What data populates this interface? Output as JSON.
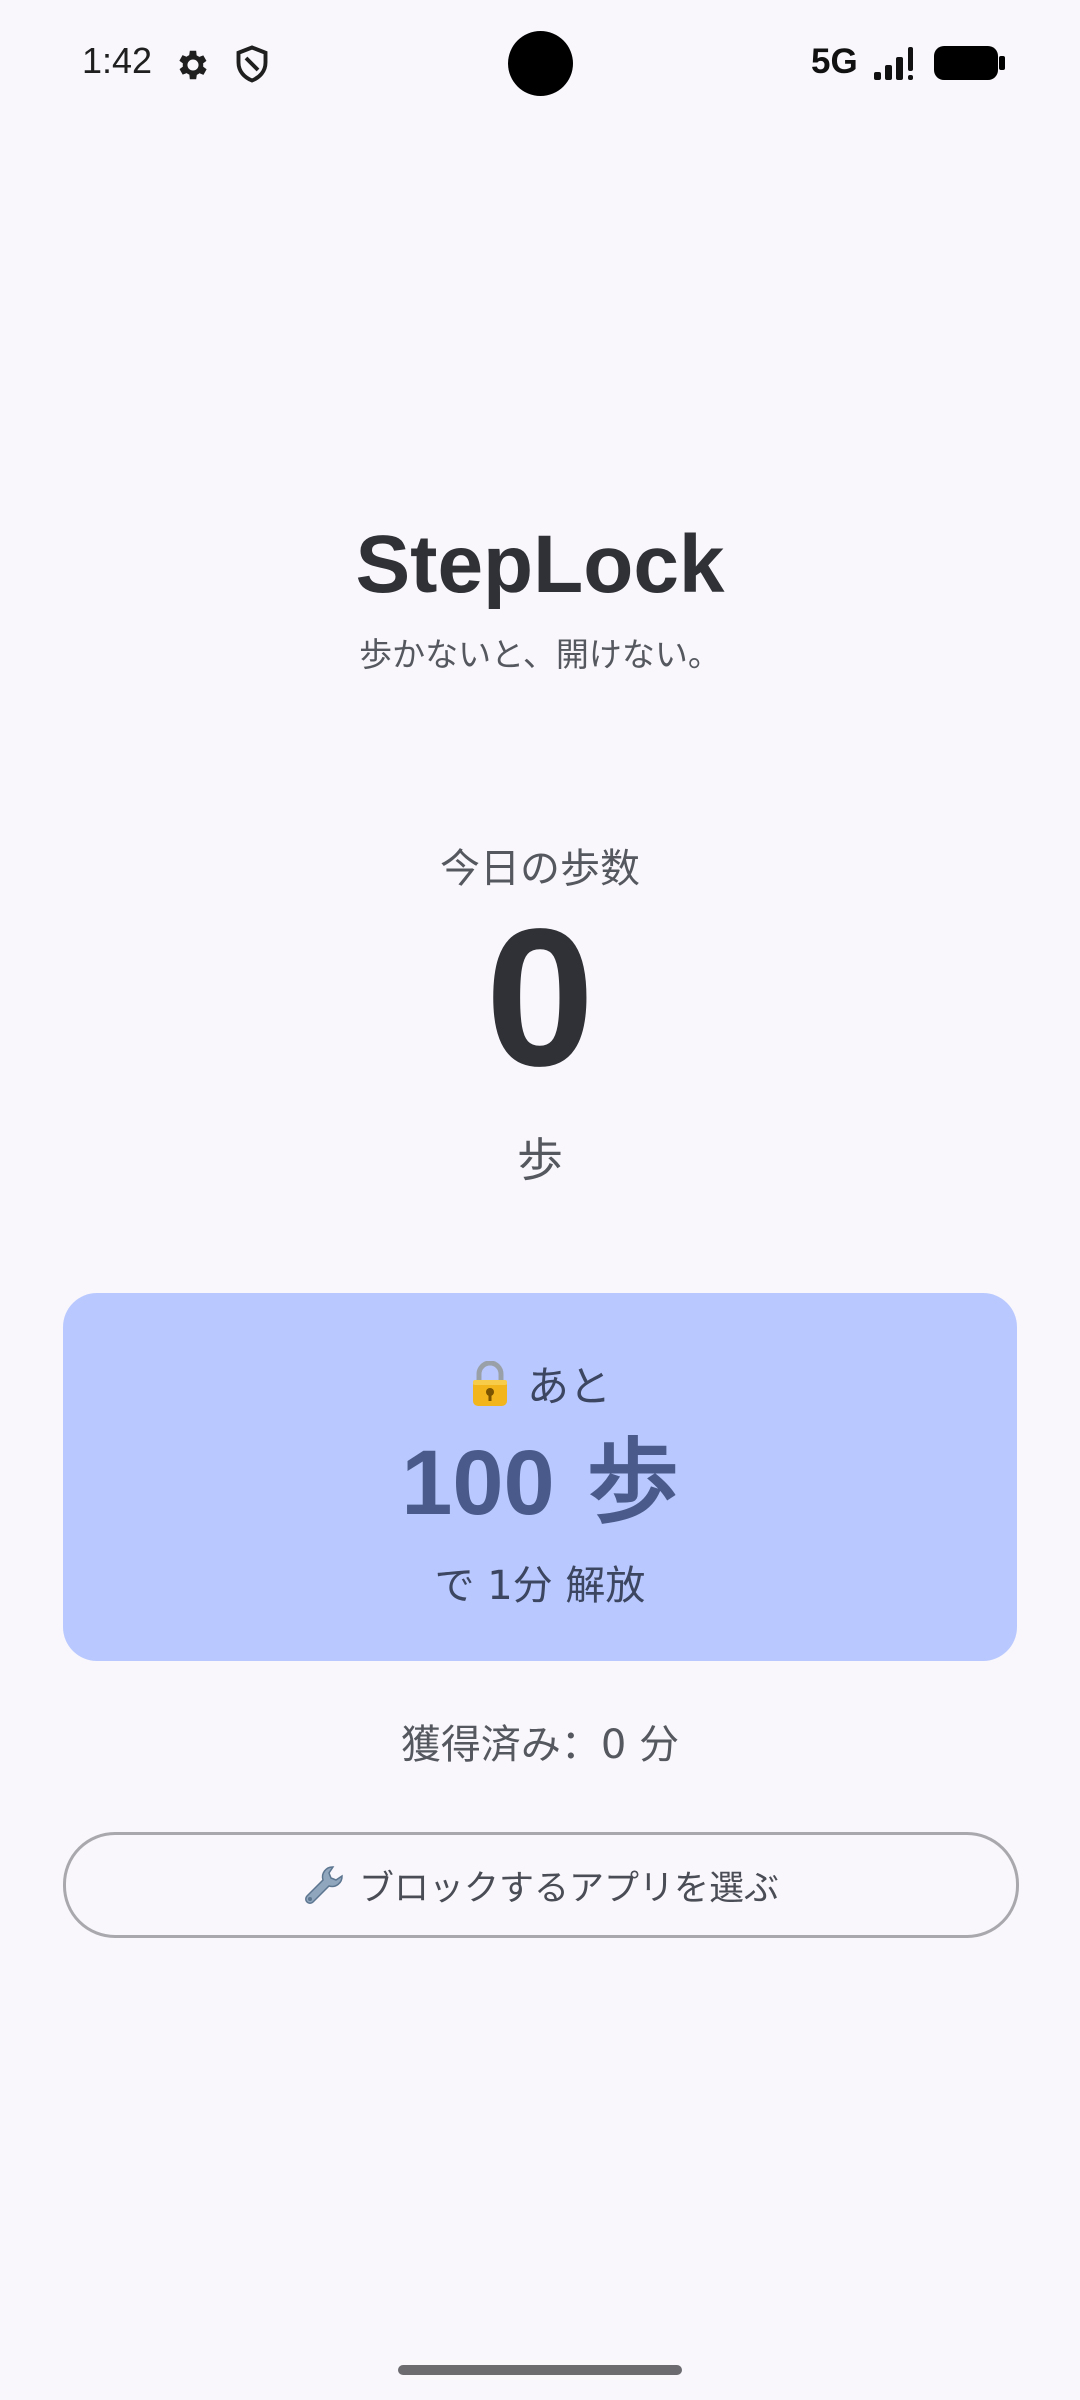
{
  "status_bar": {
    "time": "1:42",
    "network": "5G",
    "icons": [
      "settings-icon",
      "shield-icon",
      "signal-icon",
      "battery-icon"
    ]
  },
  "app": {
    "title": "StepLock",
    "tagline": "歩かないと、開けない。"
  },
  "steps": {
    "label": "今日の歩数",
    "count": "0",
    "unit": "歩"
  },
  "unlock_card": {
    "icon": "lock-icon",
    "prefix": "あと",
    "remaining": "100",
    "remaining_unit": "歩",
    "suffix": "で 1分 解放",
    "background_color": "#b9c9ff",
    "text_color": "#4a5b8b"
  },
  "earned": {
    "text": "獲得済み：0 分"
  },
  "select_apps_button": {
    "icon": "wrench-icon",
    "label": "ブロックするアプリを選ぶ"
  }
}
